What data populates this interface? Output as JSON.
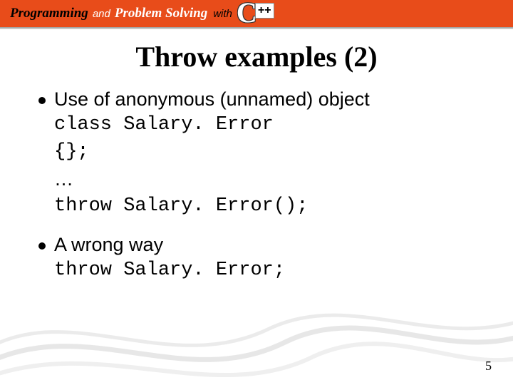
{
  "banner": {
    "programming": "Programming",
    "and": "and",
    "problem_solving": "Problem Solving",
    "with": "with",
    "logo_c": "C",
    "logo_pp": "++"
  },
  "title": "Throw examples (2)",
  "bullets": [
    {
      "lead": "Use of anonymous (unnamed) object",
      "code": [
        "class Salary. Error",
        "{};",
        "…",
        "throw Salary. Error();"
      ]
    },
    {
      "lead": "A wrong way",
      "code": [
        "throw Salary. Error;"
      ]
    }
  ],
  "page_number": "5"
}
